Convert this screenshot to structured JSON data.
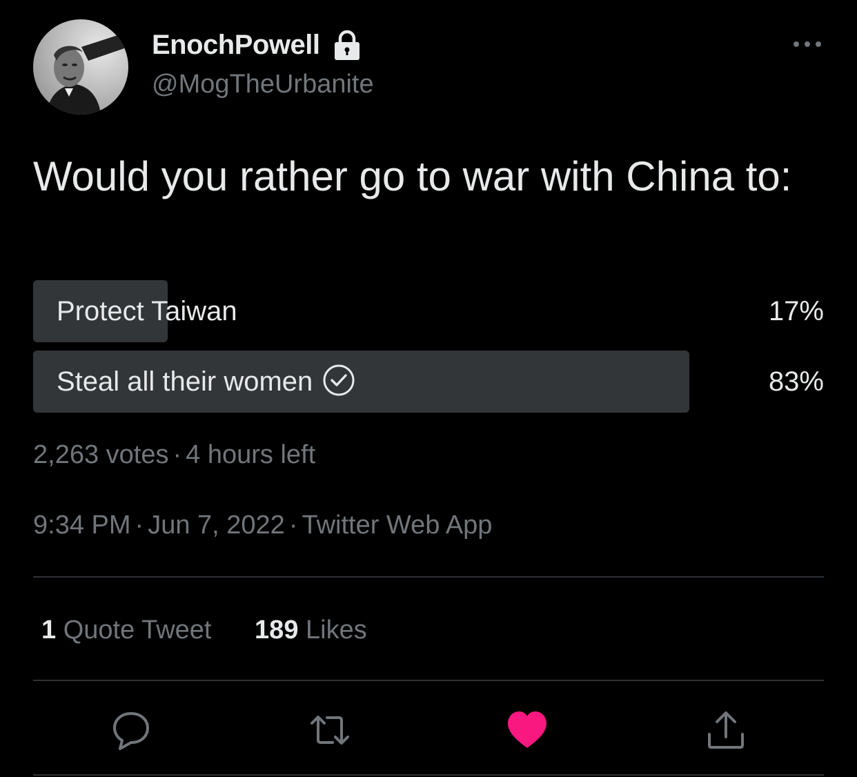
{
  "user": {
    "display_name": "EnochPowell",
    "handle": "@MogTheUrbanite",
    "protected_icon": "lock-icon",
    "avatar": "profile-photo"
  },
  "tweet": {
    "text": "Would you rather go to war with China to:"
  },
  "poll": {
    "options": [
      {
        "label": "Protect Taiwan",
        "percent_label": "17%",
        "fraction": 0.17,
        "selected": false
      },
      {
        "label": "Steal all their women",
        "percent_label": "83%",
        "fraction": 0.83,
        "selected": true
      }
    ],
    "votes": "2,263 votes",
    "time_left": "4 hours left",
    "separator": "·"
  },
  "meta": {
    "time": "9:34 PM",
    "date": "Jun 7, 2022",
    "source": "Twitter Web App"
  },
  "stats": {
    "quote_count": "1",
    "quote_label": "Quote Tweet",
    "like_count": "189",
    "like_label": "Likes"
  },
  "actions": [
    "reply-icon",
    "retweet-icon",
    "like-icon",
    "share-icon"
  ],
  "colors": {
    "background": "#000000",
    "text": "#e7e9ea",
    "secondary": "#71767b",
    "poll_bar": "#333639",
    "divider": "#2f3336",
    "like": "#f91880"
  }
}
